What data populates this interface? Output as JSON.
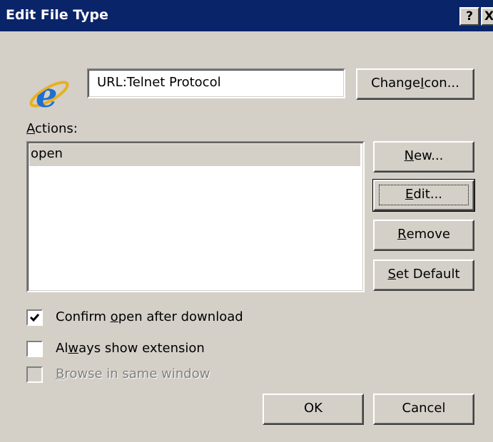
{
  "window": {
    "title": "Edit File Type",
    "help_label": "?",
    "close_label": "X"
  },
  "icon": "internet-explorer-icon",
  "type_description": "URL:Telnet Protocol",
  "buttons": {
    "change_icon": {
      "pre": "Change ",
      "accel": "I",
      "post": "con..."
    },
    "new": {
      "pre": "",
      "accel": "N",
      "post": "ew..."
    },
    "edit": {
      "pre": "",
      "accel": "E",
      "post": "dit..."
    },
    "remove": {
      "pre": "",
      "accel": "R",
      "post": "emove"
    },
    "set_default": {
      "pre": "",
      "accel": "S",
      "post": "et Default"
    },
    "ok": "OK",
    "cancel": "Cancel"
  },
  "actions": {
    "label_accel": "A",
    "label_rest": "ctions:",
    "items": [
      "open"
    ]
  },
  "options": {
    "confirm_open": {
      "pre": "Confirm ",
      "accel": "o",
      "post": "pen after download",
      "checked": true,
      "enabled": true
    },
    "always_show_ext": {
      "pre": "Al",
      "accel": "w",
      "post": "ays show extension",
      "checked": false,
      "enabled": true
    },
    "browse_same_window": {
      "pre": "",
      "accel": "B",
      "post": "rowse in same window",
      "checked": false,
      "enabled": false
    }
  },
  "colors": {
    "title_bar": "#0a246a",
    "dialog_bg": "#d4d0c8",
    "ie_blue": "#1f6fd1"
  }
}
